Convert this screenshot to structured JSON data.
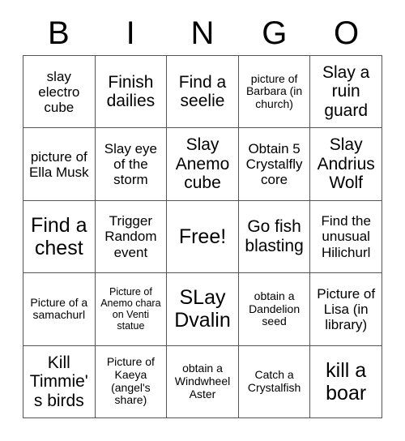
{
  "card": {
    "title": "BINGO",
    "headers": [
      "B",
      "I",
      "N",
      "G",
      "O"
    ],
    "grid_border_color": "#555555",
    "background_color": "#ffffff",
    "text_color": "#000000",
    "rows": 5,
    "columns": 5,
    "free_space": "Free!",
    "cells": [
      [
        {
          "text": "slay electro cube",
          "size": "md"
        },
        {
          "text": "Finish dailies",
          "size": "lg"
        },
        {
          "text": "Find a seelie",
          "size": "lg"
        },
        {
          "text": "picture of Barbara (in church)",
          "size": "sm"
        },
        {
          "text": "Slay a ruin guard",
          "size": "lg"
        }
      ],
      [
        {
          "text": "picture of Ella Musk",
          "size": "md"
        },
        {
          "text": "Slay eye of the storm",
          "size": "md"
        },
        {
          "text": "Slay Anemo cube",
          "size": "lg"
        },
        {
          "text": "Obtain 5 Crystalfly core",
          "size": "md"
        },
        {
          "text": "Slay Andrius Wolf",
          "size": "lg"
        }
      ],
      [
        {
          "text": "Find a chest",
          "size": "xl"
        },
        {
          "text": "Trigger Random event",
          "size": "md"
        },
        {
          "text": "Free!",
          "size": "xl"
        },
        {
          "text": "Go fish blasting",
          "size": "lg"
        },
        {
          "text": "Find the unusual Hilichurl",
          "size": "md"
        }
      ],
      [
        {
          "text": "Picture of a samachurl",
          "size": "sm"
        },
        {
          "text": "Picture of Anemo chara on Venti statue",
          "size": "xs"
        },
        {
          "text": "SLay Dvalin",
          "size": "xl"
        },
        {
          "text": "obtain a Dandelion seed",
          "size": "sm"
        },
        {
          "text": "Picture of Lisa (in library)",
          "size": "md"
        }
      ],
      [
        {
          "text": "Kill Timmie's birds",
          "size": "lg"
        },
        {
          "text": "Picture of Kaeya (angel's share)",
          "size": "sm"
        },
        {
          "text": "obtain a Windwheel Aster",
          "size": "sm"
        },
        {
          "text": "Catch a Crystalfish",
          "size": "sm"
        },
        {
          "text": "kill a boar",
          "size": "xl"
        }
      ]
    ]
  }
}
